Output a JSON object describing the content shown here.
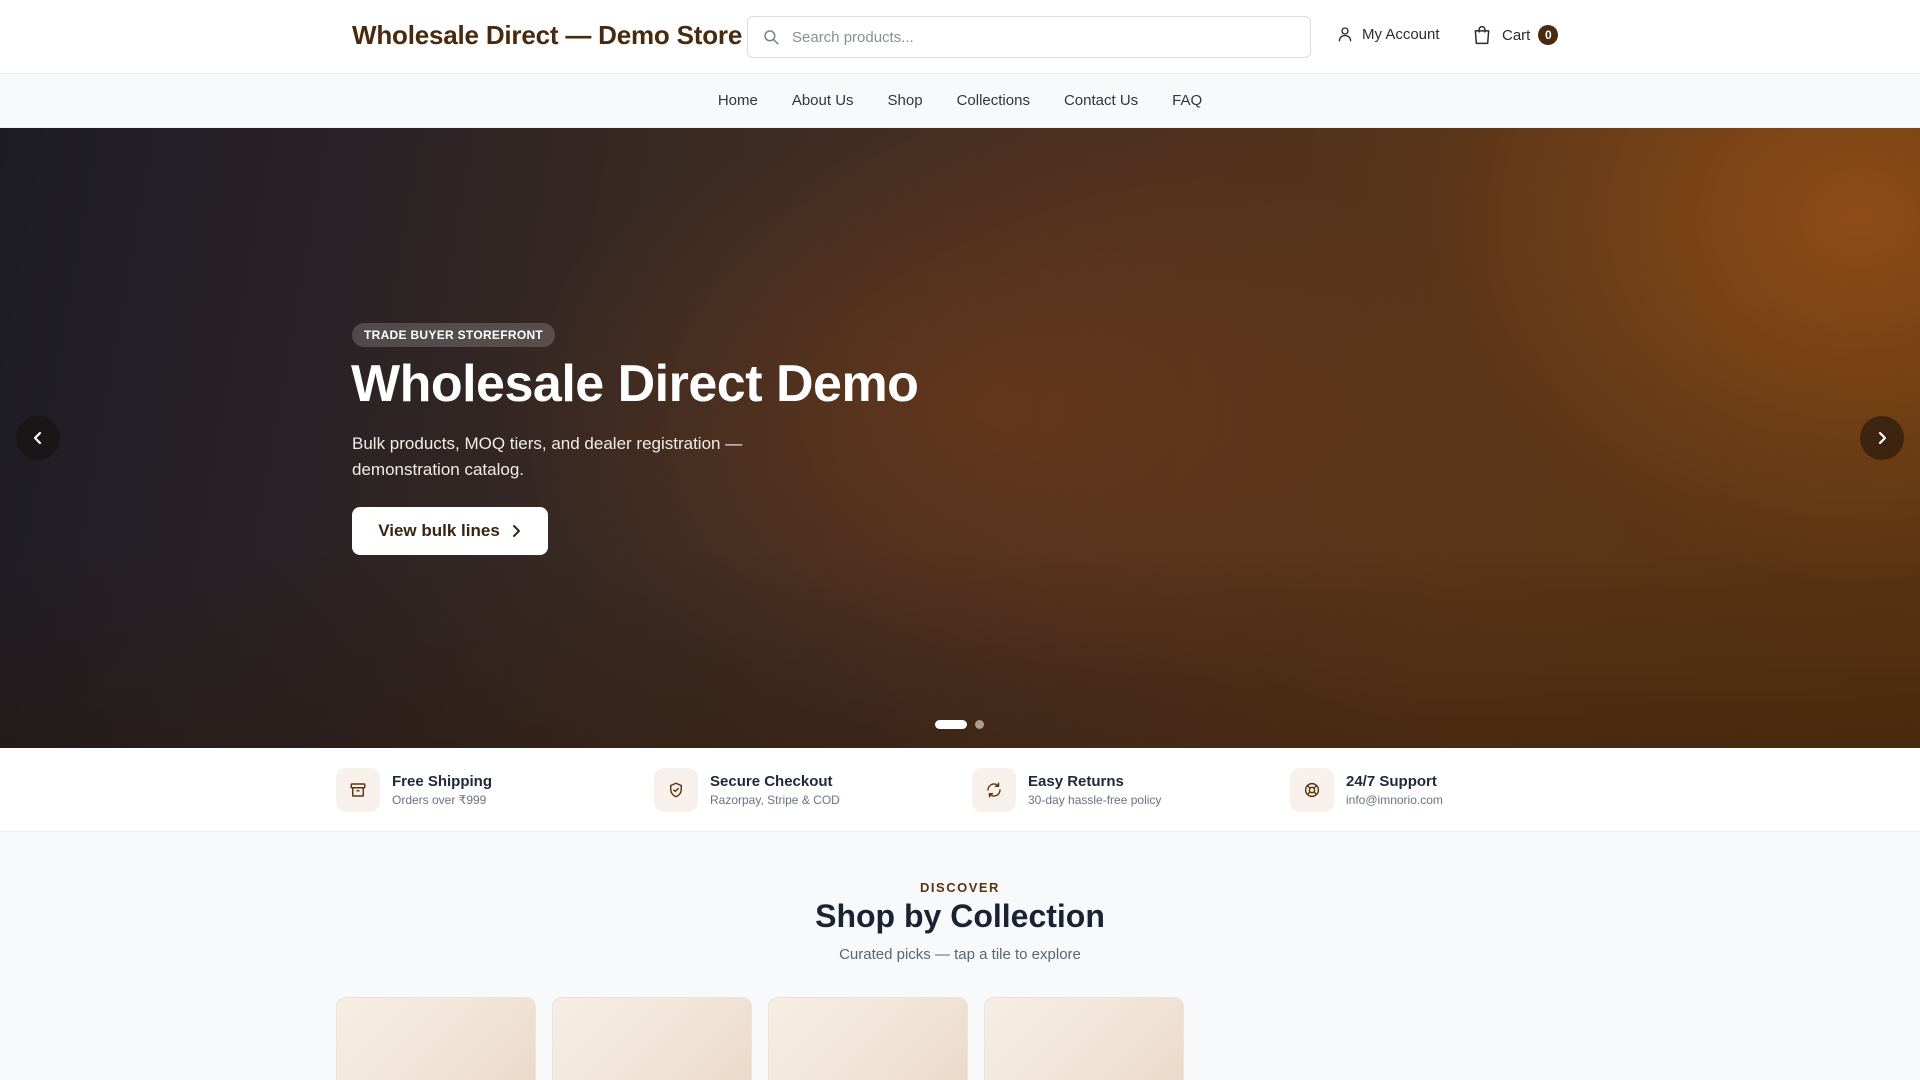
{
  "header": {
    "logo": "Wholesale Direct — Demo Store",
    "search_placeholder": "Search products...",
    "account_label": "My Account",
    "cart_label": "Cart",
    "cart_count": "0"
  },
  "nav": {
    "items": [
      {
        "label": "Home"
      },
      {
        "label": "About Us"
      },
      {
        "label": "Shop"
      },
      {
        "label": "Collections"
      },
      {
        "label": "Contact Us"
      },
      {
        "label": "FAQ"
      }
    ]
  },
  "hero": {
    "tag": "TRADE BUYER STOREFRONT",
    "title": "Wholesale Direct Demo",
    "subtitle": "Bulk products, MOQ tiers, and dealer registration — demonstration catalog.",
    "cta_label": "View bulk lines",
    "prev_icon": "‹",
    "next_icon": "›",
    "active_slide": 1,
    "slide_count": 2
  },
  "features": [
    {
      "icon": "box-icon",
      "title": "Free Shipping",
      "subtitle": "Orders over ₹999"
    },
    {
      "icon": "shield-check-icon",
      "title": "Secure Checkout",
      "subtitle": "Razorpay, Stripe & COD"
    },
    {
      "icon": "refresh-icon",
      "title": "Easy Returns",
      "subtitle": "30-day hassle-free policy"
    },
    {
      "icon": "lifebuoy-icon",
      "title": "24/7 Support",
      "subtitle": "info@imnorio.com"
    }
  ],
  "collections": {
    "eyebrow": "DISCOVER",
    "title": "Shop by Collection",
    "subtitle": "Curated picks — tap a tile to explore",
    "tile_count": 4
  },
  "colors": {
    "brand": "#4a2a0e",
    "accent_bg": "#f8f0ea"
  }
}
